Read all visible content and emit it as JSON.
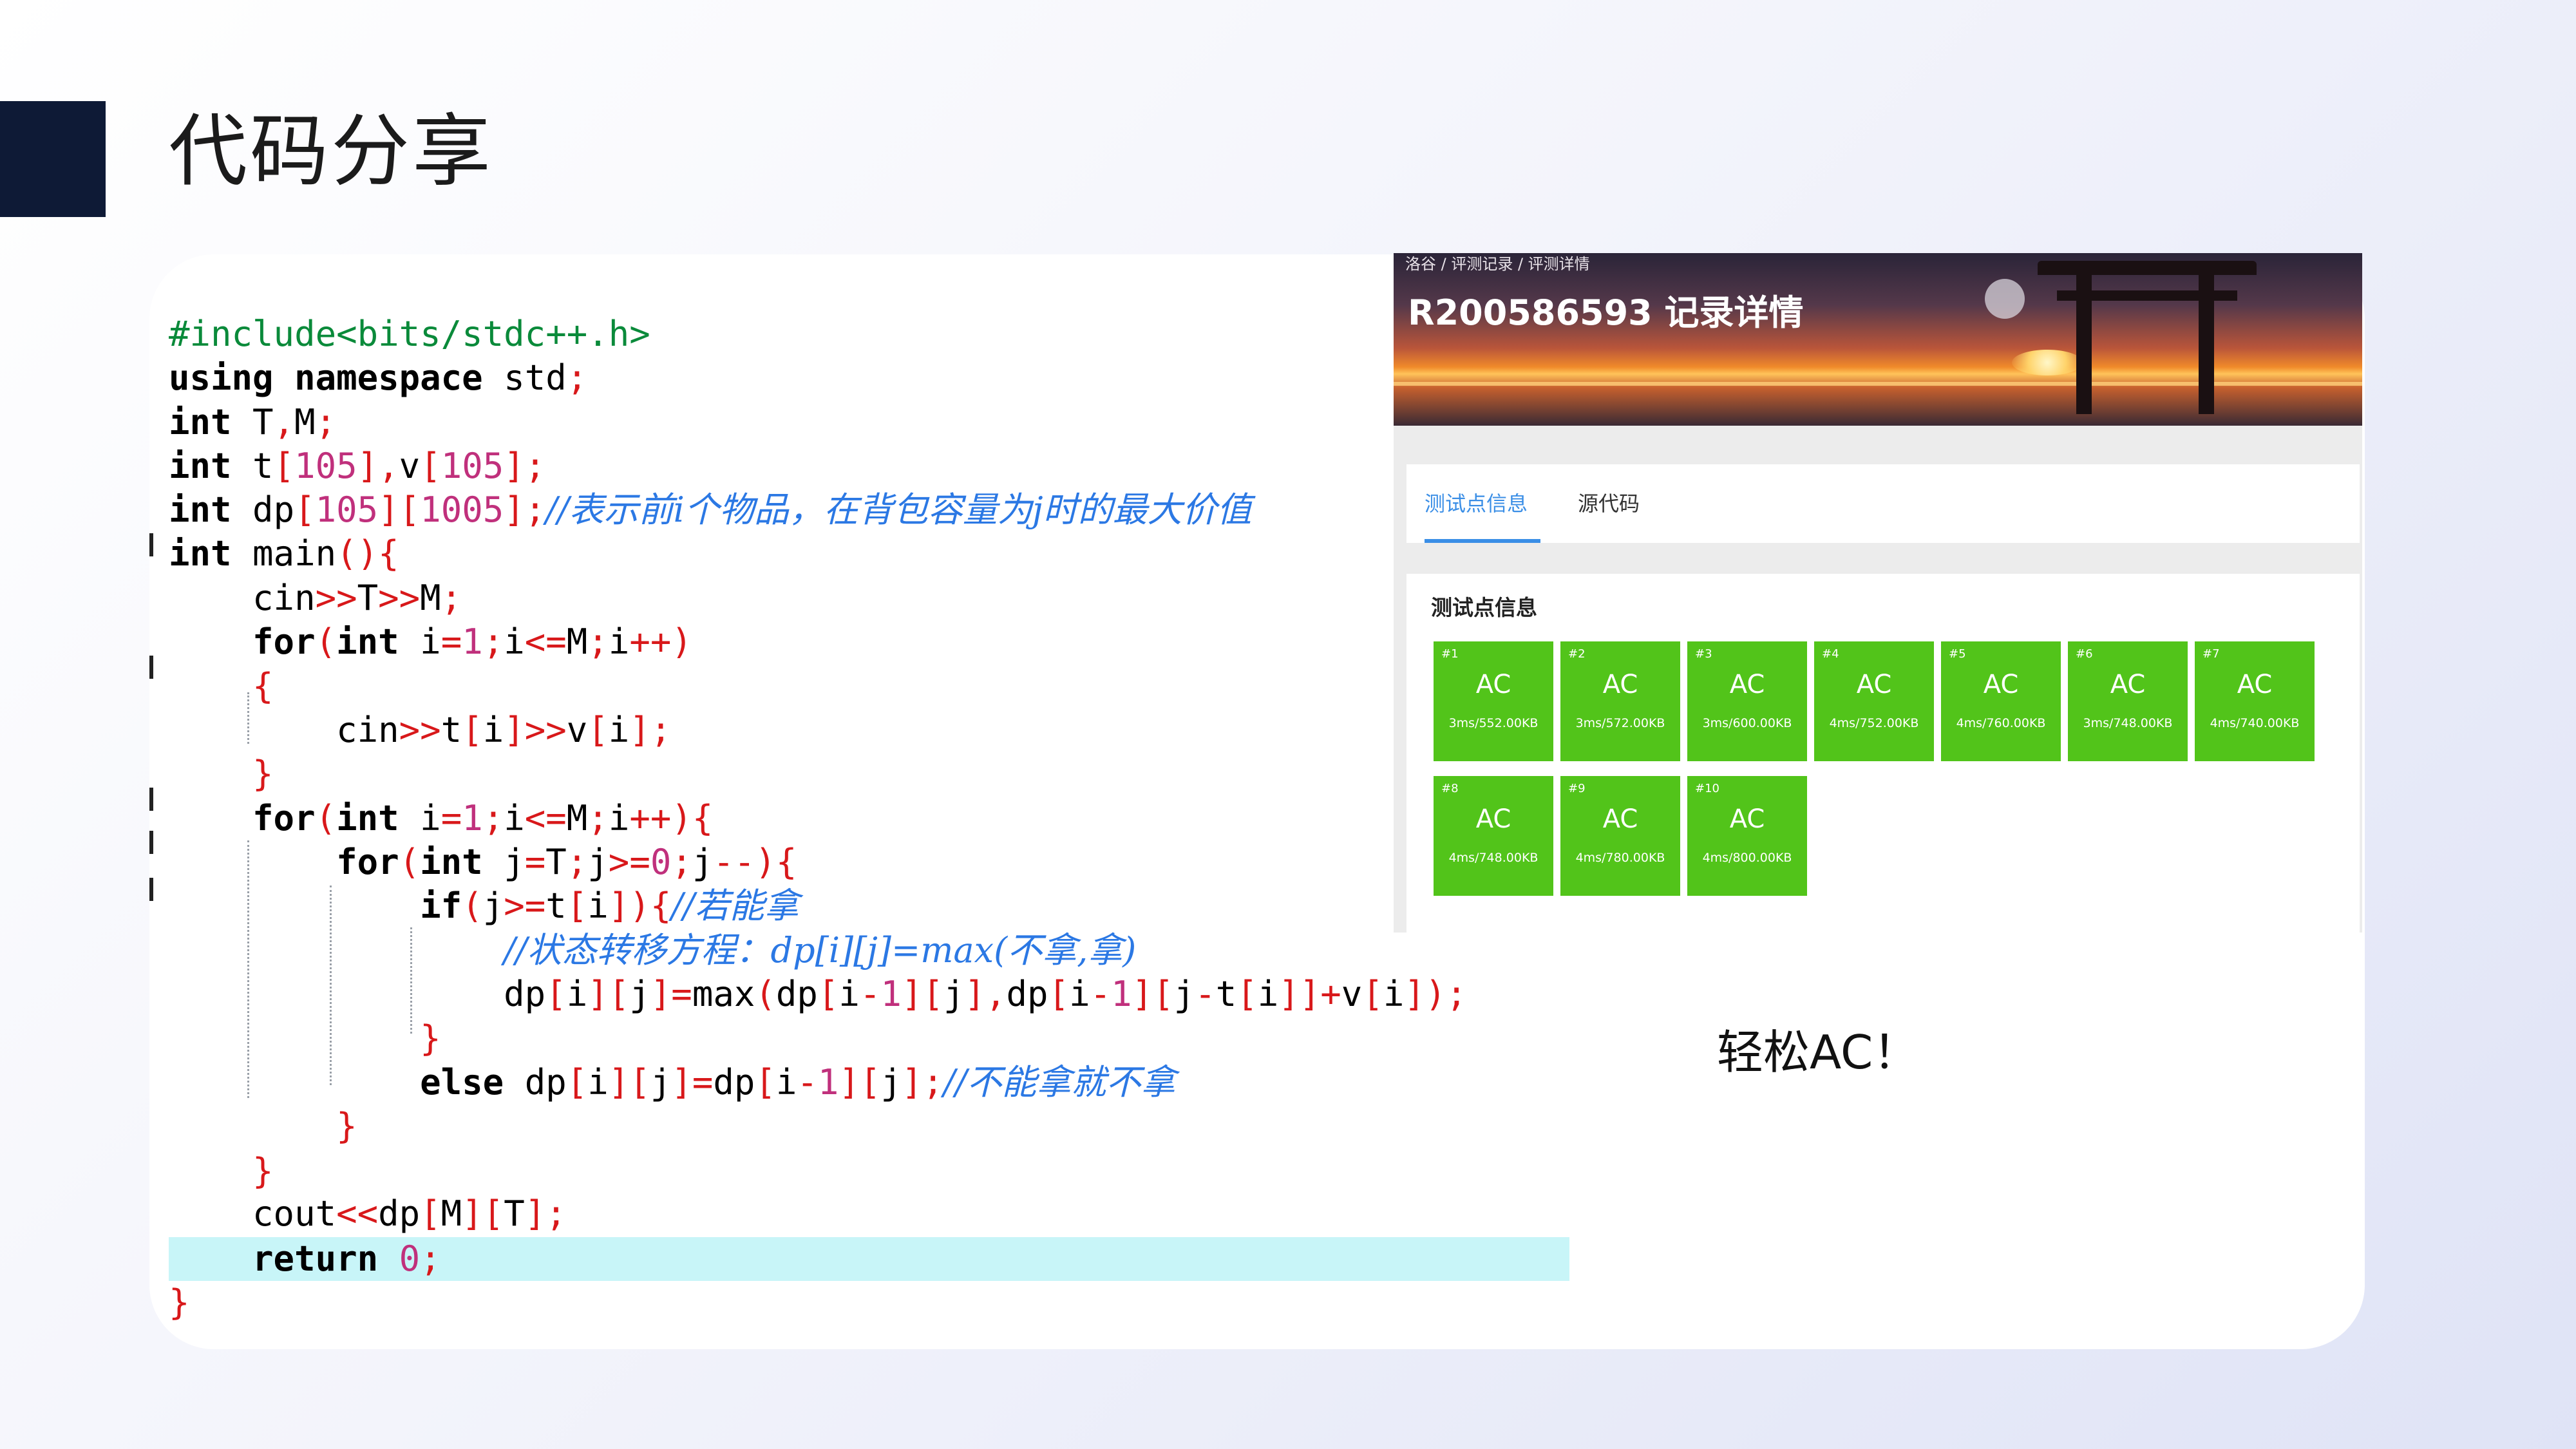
{
  "slide": {
    "title": "代码分享",
    "caption": "轻松AC！"
  },
  "code": {
    "language": "cpp",
    "lines": [
      "#include<bits/stdc++.h>",
      "using namespace std;",
      "int T,M;",
      "int t[105],v[105];",
      "int dp[105][1005];//表示前i个物品，在背包容量为j时的最大价值",
      "int main(){",
      "    cin>>T>>M;",
      "    for(int i=1;i<=M;i++)",
      "    {",
      "        cin>>t[i]>>v[i];",
      "    }",
      "    for(int i=1;i<=M;i++){",
      "        for(int j=T;j>=0;j--){",
      "            if(j>=t[i]){//若能拿",
      "                //状态转移方程：dp[i][j]=max(不拿,拿)",
      "                dp[i][j]=max(dp[i-1][j],dp[i-1][j-t[i]]+v[i]);",
      "            }",
      "            else dp[i][j]=dp[i-1][j];//不能拿就不拿",
      "        }",
      "    }",
      "    cout<<dp[M][T];",
      "    return 0;",
      "}"
    ],
    "highlighted_line": 21
  },
  "record": {
    "breadcrumb": "洛谷 / 评测记录 / 评测详情",
    "title": "R200586593 记录详情",
    "tabs": [
      {
        "label": "测试点信息",
        "active": true
      },
      {
        "label": "源代码",
        "active": false
      }
    ],
    "section_title": "测试点信息",
    "accent_color": "#3a8ee6",
    "ac_color": "#52c41a",
    "testcases": [
      {
        "id": "#1",
        "status": "AC",
        "info": "3ms/552.00KB"
      },
      {
        "id": "#2",
        "status": "AC",
        "info": "3ms/572.00KB"
      },
      {
        "id": "#3",
        "status": "AC",
        "info": "3ms/600.00KB"
      },
      {
        "id": "#4",
        "status": "AC",
        "info": "4ms/752.00KB"
      },
      {
        "id": "#5",
        "status": "AC",
        "info": "4ms/760.00KB"
      },
      {
        "id": "#6",
        "status": "AC",
        "info": "3ms/748.00KB"
      },
      {
        "id": "#7",
        "status": "AC",
        "info": "4ms/740.00KB"
      },
      {
        "id": "#8",
        "status": "AC",
        "info": "4ms/748.00KB"
      },
      {
        "id": "#9",
        "status": "AC",
        "info": "4ms/780.00KB"
      },
      {
        "id": "#10",
        "status": "AC",
        "info": "4ms/800.00KB"
      }
    ]
  }
}
